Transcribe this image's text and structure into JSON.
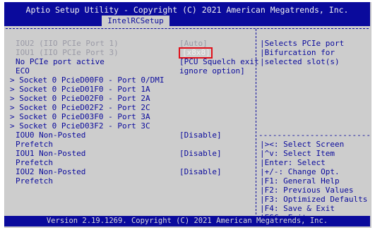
{
  "header": {
    "title": "Aptio Setup Utility - Copyright (C) 2021 American Megatrends, Inc.",
    "tab": "IntelRCSetup"
  },
  "items": [
    {
      "label": "IOU2 (IIO PCIe Port 1)",
      "value": "[Auto]"
    },
    {
      "label": "IOU1 (IIO PCIe Port 3)",
      "value": "[x8x8]"
    },
    {
      "label": "No PCIe port active",
      "value": "[PCU Squelch exit"
    },
    {
      "label": "ECO",
      "value": "ignore option]"
    },
    {
      "label": "> Socket 0 PcieD00F0 - Port 0/DMI"
    },
    {
      "label": "> Socket 0 PcieD01F0 - Port 1A"
    },
    {
      "label": "> Socket 0 PcieD02F0 - Port 2A"
    },
    {
      "label": "> Socket 0 PcieD02F2 - Port 2C"
    },
    {
      "label": "> Socket 0 PcieD03F0 - Port 3A"
    },
    {
      "label": "> Socket 0 PcieD03F2 - Port 3C"
    },
    {
      "label": "IOU0 Non-Posted",
      "value": "[Disable]"
    },
    {
      "label": "Prefetch"
    },
    {
      "label": "IOU1 Non-Posted",
      "value": "[Disable]"
    },
    {
      "label": "Prefetch"
    },
    {
      "label": "IOU2 Non-Posted",
      "value": "[Disable]"
    },
    {
      "label": "Prefetch"
    }
  ],
  "help": {
    "lines": [
      "Selects PCIe port",
      "Bifurcation for",
      "selected slot(s)"
    ]
  },
  "keys": {
    "divider": "------------------------",
    "lines": [
      "><: Select Screen",
      "^v: Select Item",
      "Enter: Select",
      "+/-: Change Opt.",
      "F1: General Help",
      "F2: Previous Values",
      "F3: Optimized Defaults",
      "F4: Save & Exit",
      "ESC: Exit"
    ]
  },
  "footer": {
    "text": "Version 2.19.1269. Copyright (C) 2021 American Megatrends, Inc."
  },
  "colors": {
    "bios_blue": "#0a0a9c",
    "panel_gray": "#cdcdcd",
    "highlight_red": "#e0101a"
  }
}
